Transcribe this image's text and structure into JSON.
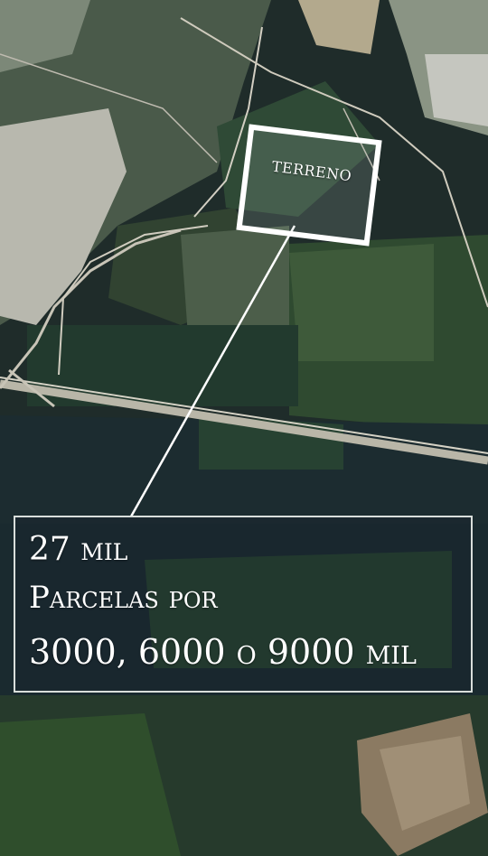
{
  "map": {
    "marker_label": "TERRENO"
  },
  "info": {
    "line1": "27 mil",
    "line2": "Parcelas por",
    "line3": "3000, 6000 o 9000 mil"
  },
  "colors": {
    "frame": "#ffffff",
    "text": "#ffffff",
    "panel_border": "#d9dedb"
  }
}
